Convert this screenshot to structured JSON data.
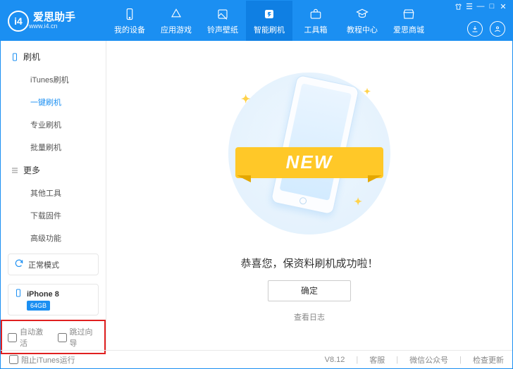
{
  "app": {
    "name": "爱思助手",
    "site": "www.i4.cn",
    "logo_letter": "i4"
  },
  "window_controls": {
    "menu": "☰",
    "lock": "🔒",
    "min": "—",
    "max": "□",
    "close": "✕"
  },
  "nav": [
    {
      "key": "devices",
      "label": "我的设备",
      "active": false
    },
    {
      "key": "apps",
      "label": "应用游戏",
      "active": false
    },
    {
      "key": "themes",
      "label": "铃声壁纸",
      "active": false
    },
    {
      "key": "flash",
      "label": "智能刷机",
      "active": true
    },
    {
      "key": "toolbox",
      "label": "工具箱",
      "active": false
    },
    {
      "key": "tutorial",
      "label": "教程中心",
      "active": false
    },
    {
      "key": "mall",
      "label": "爱思商城",
      "active": false
    }
  ],
  "sidebar": {
    "group_flash": {
      "title": "刷机",
      "items": [
        {
          "key": "itunes",
          "label": "iTunes刷机",
          "selected": false
        },
        {
          "key": "oneclick",
          "label": "一键刷机",
          "selected": true
        },
        {
          "key": "pro",
          "label": "专业刷机",
          "selected": false
        },
        {
          "key": "batch",
          "label": "批量刷机",
          "selected": false
        }
      ]
    },
    "group_more": {
      "title": "更多",
      "items": [
        {
          "key": "other",
          "label": "其他工具"
        },
        {
          "key": "firmware",
          "label": "下载固件"
        },
        {
          "key": "adv",
          "label": "高级功能"
        }
      ]
    },
    "mode": {
      "label": "正常模式"
    },
    "device": {
      "name": "iPhone 8",
      "storage": "64GB"
    },
    "bottom": {
      "auto_activate": "自动激活",
      "skip_wizard": "跳过向导"
    }
  },
  "main": {
    "ribbon_text": "NEW",
    "success_msg": "恭喜您，保资料刷机成功啦！",
    "ok": "确定",
    "view_log": "查看日志"
  },
  "footer": {
    "block_itunes": "阻止iTunes运行",
    "version": "V8.12",
    "support": "客服",
    "wechat": "微信公众号",
    "update": "检查更新"
  }
}
